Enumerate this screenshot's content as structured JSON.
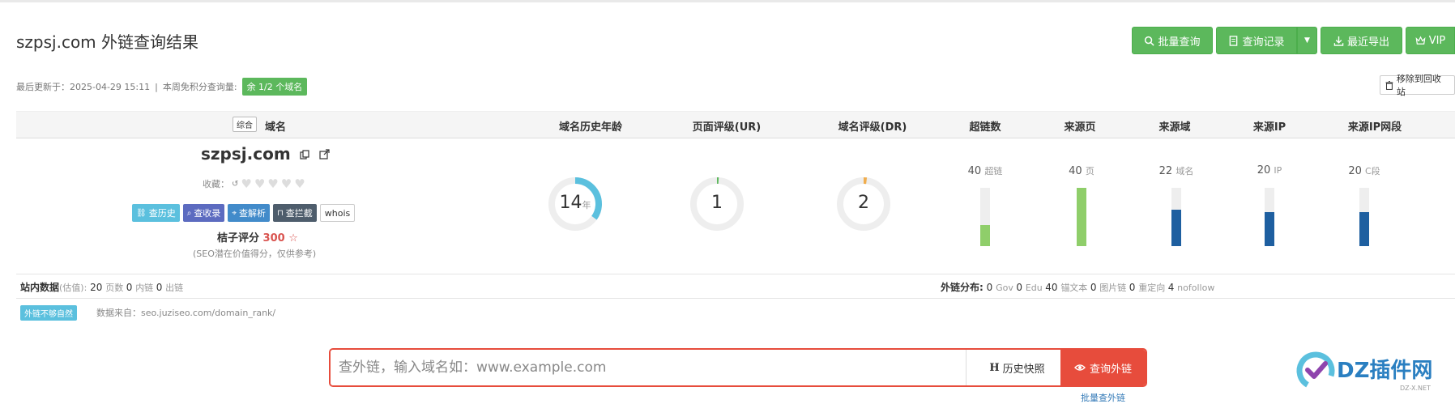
{
  "page": {
    "title": "szpsj.com 外链查询结果"
  },
  "toolbar": {
    "bulk_query": "批量查询",
    "query_history": "查询记录",
    "recent_export": "最近导出",
    "vip": "VIP",
    "color": "#5cb85c"
  },
  "meta": {
    "updated_label": "最后更新于：",
    "updated_time": "2025-04-29 15:11",
    "separator": "|",
    "quota_label": "本周免积分查询量:",
    "quota_badge": "余 1/2 个域名",
    "recycle_button": "移除到回收站"
  },
  "table": {
    "sort_button": "综合",
    "headers": [
      "域名",
      "域名历史年龄",
      "页面评级(UR)",
      "域名评级(DR)",
      "超链数",
      "来源页",
      "来源域",
      "来源IP",
      "来源IP网段"
    ]
  },
  "domain": {
    "name": "szpsj.com",
    "favorite_label": "收藏：",
    "tags": [
      {
        "label": "查历史",
        "color": "#5bc0de",
        "icon": "link-icon"
      },
      {
        "label": "查收录",
        "color": "#5c6bc0",
        "icon": "search-icon"
      },
      {
        "label": "查解析",
        "color": "#428bca",
        "icon": "map-pin-icon"
      },
      {
        "label": "查拦截",
        "color": "#4e5d6c",
        "icon": "lock-icon"
      },
      {
        "label": "whois",
        "color": "#ffffff",
        "icon": ""
      }
    ],
    "score_label": "桔子评分",
    "score_value": "300",
    "score_note": "(SEO潜在价值得分，仅供参考)"
  },
  "rings": {
    "age": {
      "value": "14",
      "unit": "年",
      "fraction": 0.35,
      "color": "#5bc0de"
    },
    "ur": {
      "value": "1",
      "fraction": 0.01,
      "color": "#5cb85c"
    },
    "dr": {
      "value": "2",
      "fraction": 0.02,
      "color": "#f0ad4e"
    }
  },
  "stats": [
    {
      "value": "40",
      "unit": "超链",
      "fill": 0.36,
      "color": "#8fce6a"
    },
    {
      "value": "40",
      "unit": "页",
      "fill": 1.0,
      "color": "#8fce6a"
    },
    {
      "value": "22",
      "unit": "域名",
      "fill": 0.63,
      "color": "#1e5fa0"
    },
    {
      "value": "20",
      "unit": "IP",
      "fill": 0.58,
      "color": "#1e5fa0"
    },
    {
      "value": "20",
      "unit": "C段",
      "fill": 0.58,
      "color": "#1e5fa0"
    }
  ],
  "site_data": {
    "label": "站内数据",
    "estimate": "(估值):",
    "items": [
      {
        "value": "20",
        "unit": "页数"
      },
      {
        "value": "0",
        "unit": "内链"
      },
      {
        "value": "0",
        "unit": "出链"
      }
    ]
  },
  "link_distribution": {
    "label": "外链分布:",
    "items": [
      {
        "value": "0",
        "unit": "Gov"
      },
      {
        "value": "0",
        "unit": "Edu"
      },
      {
        "value": "40",
        "unit": "锚文本"
      },
      {
        "value": "0",
        "unit": "图片链"
      },
      {
        "value": "0",
        "unit": "重定向"
      },
      {
        "value": "4",
        "unit": "nofollow"
      }
    ]
  },
  "notice": {
    "badge": "外链不够自然",
    "source_label": "数据来自：",
    "source_url": "seo.juziseo.com/domain_rank/"
  },
  "search": {
    "placeholder": "查外链，输入域名如：www.example.com",
    "snapshot_prefix": "H",
    "snapshot_label": "历史快照",
    "submit": "查询外链",
    "bulk_link": "批量查外链"
  },
  "watermark": {
    "text": "DZ插件网",
    "sub": "DZ-X.NET"
  }
}
